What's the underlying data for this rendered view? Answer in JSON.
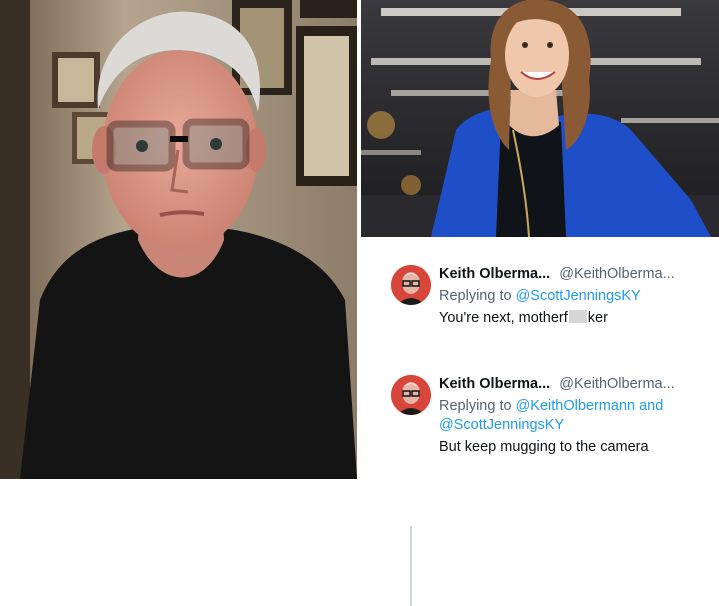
{
  "tweets": [
    {
      "name": "Keith Olberma...",
      "handle": "@KeithOlberma...",
      "replying_prefix": "Replying to",
      "mentions_line1": "@ScottJenningsKY",
      "mentions_line2": "",
      "text_before": "You're next, motherf",
      "text_after": "ker"
    },
    {
      "name": "Keith Olberma...",
      "handle": "@KeithOlberma...",
      "replying_prefix": "Replying to",
      "mentions_line1": "@KeithOlbermann and",
      "mentions_line2": "@ScottJenningsKY",
      "text_before": "But keep mugging to the camera",
      "text_after": ""
    }
  ],
  "colors": {
    "link": "#1d9bf0",
    "muted": "#536471",
    "text": "#0f1419",
    "avatar_bg": "#d8453a",
    "blazer": "#1f4fc8"
  }
}
